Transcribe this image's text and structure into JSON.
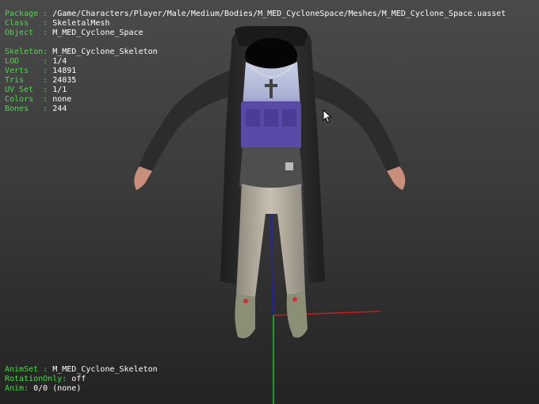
{
  "overlay_colors": {
    "key": "#3ee23e",
    "value": "#ffffff"
  },
  "top_info": [
    {
      "key": "Package",
      "sep": " : ",
      "value": "/Game/Characters/Player/Male/Medium/Bodies/M_MED_CycloneSpace/Meshes/M_MED_Cyclone_Space.uasset"
    },
    {
      "key": "Class  ",
      "sep": " : ",
      "value": "SkeletalMesh"
    },
    {
      "key": "Object ",
      "sep": " : ",
      "value": "M_MED_Cyclone_Space"
    },
    {
      "key": "",
      "sep": "",
      "value": ""
    },
    {
      "key": "Skeleton",
      "sep": ": ",
      "value": "M_MED_Cyclone_Skeleton"
    },
    {
      "key": "LOD    ",
      "sep": " : ",
      "value": "1/4"
    },
    {
      "key": "Verts  ",
      "sep": " : ",
      "value": "14891"
    },
    {
      "key": "Tris   ",
      "sep": " : ",
      "value": "24035"
    },
    {
      "key": "UV Set ",
      "sep": " : ",
      "value": "1/1"
    },
    {
      "key": "Colors ",
      "sep": " : ",
      "value": "none"
    },
    {
      "key": "Bones  ",
      "sep": " : ",
      "value": "244"
    }
  ],
  "bottom_info": [
    {
      "key": "AnimSet",
      "sep": " : ",
      "value": "M_MED_Cyclone_Skeleton"
    },
    {
      "key": "RotationOnly",
      "sep": ": ",
      "value": "off"
    },
    {
      "key": "Anim",
      "sep": ": ",
      "value": "0/0 (none)"
    }
  ]
}
